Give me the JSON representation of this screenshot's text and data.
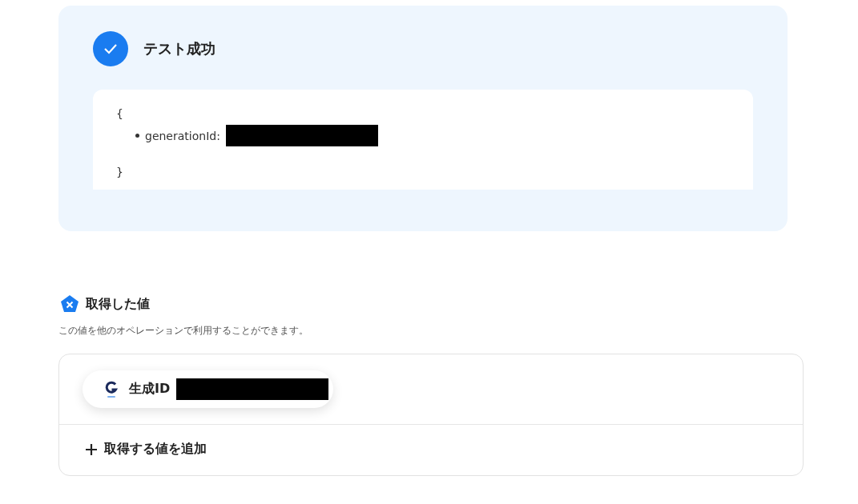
{
  "test_result": {
    "passed": true,
    "title": "テスト成功",
    "output": {
      "open_brace": "{",
      "fields": [
        {
          "key": "generationId:"
        }
      ],
      "close_brace": "}"
    }
  },
  "obtained_values": {
    "title": "取得した値",
    "description": "この値を他のオペレーションで利用することができます。",
    "items": [
      {
        "label": "生成ID"
      }
    ],
    "add_label": "取得する値を追加"
  }
}
